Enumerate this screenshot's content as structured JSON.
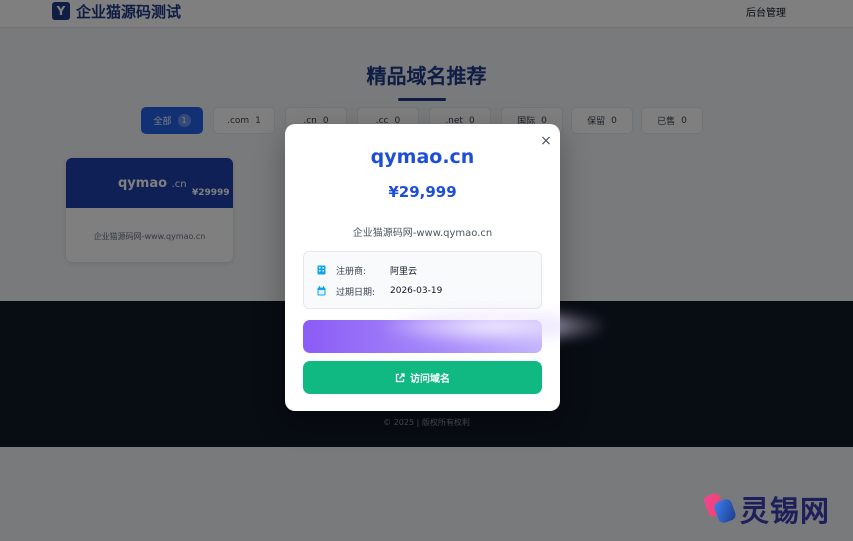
{
  "header": {
    "logo_glyph": "Y",
    "site_name": "企业猫源码测试",
    "admin_link": "后台管理"
  },
  "section": {
    "title": "精品域名推荐"
  },
  "filters": [
    {
      "label": "全部",
      "count": "1",
      "active": true
    },
    {
      "label": ".com",
      "count": "1",
      "active": false
    },
    {
      "label": ".cn",
      "count": "0",
      "active": false
    },
    {
      "label": ".cc",
      "count": "0",
      "active": false
    },
    {
      "label": ".net",
      "count": "0",
      "active": false
    },
    {
      "label": "国际",
      "count": "0",
      "active": false
    },
    {
      "label": "保留",
      "count": "0",
      "active": false
    },
    {
      "label": "已售",
      "count": "0",
      "active": false
    }
  ],
  "card": {
    "domain_name": "qymao",
    "domain_tld": ".cn",
    "price": "¥29999",
    "description": "企业猫源码网-www.qymao.cn"
  },
  "footer": {
    "copyright": "© 2025 | 版权所有权利"
  },
  "modal": {
    "close_glyph": "×",
    "domain": "qymao.cn",
    "price": "¥29,999",
    "description": "企业猫源码网-www.qymao.cn",
    "registrar_label": "注册商:",
    "registrar_value": "阿里云",
    "expiry_label": "过期日期:",
    "expiry_value": "2026-03-19",
    "visit_button": "访问域名"
  },
  "watermark": {
    "text": "灵锡网"
  },
  "colors": {
    "brand_blue": "#1e3a8a",
    "primary_blue": "#1d4ed8",
    "purple": "#8b5cf6",
    "green": "#10b981"
  },
  "icons": {
    "registrar": "building-icon",
    "expiry": "calendar-icon",
    "visit": "external-link-icon",
    "close": "close-icon"
  }
}
